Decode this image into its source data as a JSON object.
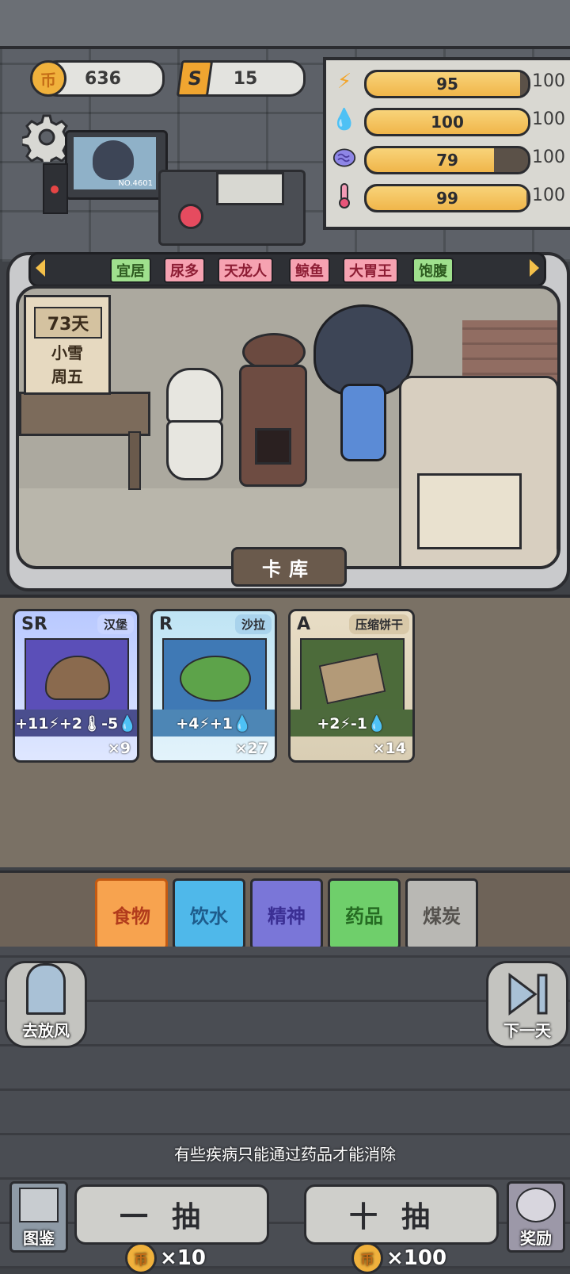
{
  "currency": {
    "coins": "636",
    "tickets": "15",
    "coin_glyph": "币",
    "ticket_glyph": "S"
  },
  "stats": [
    {
      "icon": "energy-icon",
      "value": "95",
      "max": "100",
      "fraction": 0.95
    },
    {
      "icon": "water-icon",
      "value": "100",
      "max": "100",
      "fraction": 1.0
    },
    {
      "icon": "brain-icon",
      "value": "79",
      "max": "100",
      "fraction": 0.79
    },
    {
      "icon": "thermometer-icon",
      "value": "99",
      "max": "100",
      "fraction": 0.99
    }
  ],
  "monitor": {
    "number": "NO.4601"
  },
  "traits": [
    "宜居",
    "尿多",
    "天龙人",
    "鲸鱼",
    "大胃王",
    "饱腹"
  ],
  "calendar": {
    "day": "73天",
    "weather": "小雪",
    "weekday": "周五"
  },
  "inventory_title": "卡库",
  "cards": [
    {
      "rank": "SR",
      "name": "汉堡",
      "effect": "+11⚡+2🌡-5💧",
      "count": "×9"
    },
    {
      "rank": "R",
      "name": "沙拉",
      "effect": "+4⚡+1💧",
      "count": "×27"
    },
    {
      "rank": "A",
      "name": "压缩饼干",
      "effect": "+2⚡-1💧",
      "count": "×14"
    }
  ],
  "categories": [
    "食物",
    "饮水",
    "精神",
    "药品",
    "煤炭"
  ],
  "buttons": {
    "go_out": "去放风",
    "next_day": "下一天",
    "codex": "图鉴",
    "reward": "奖励"
  },
  "tip": "有些疾病只能通过药品才能消除",
  "draw": {
    "single": "一抽",
    "single_cost": "×10",
    "ten": "十抽",
    "ten_cost": "×100"
  },
  "colors": {
    "coin": "#f0b13c",
    "bar_fill": "#f6c45c",
    "tag_green": "#9fe08d",
    "tag_pink": "#f6a2b1"
  }
}
